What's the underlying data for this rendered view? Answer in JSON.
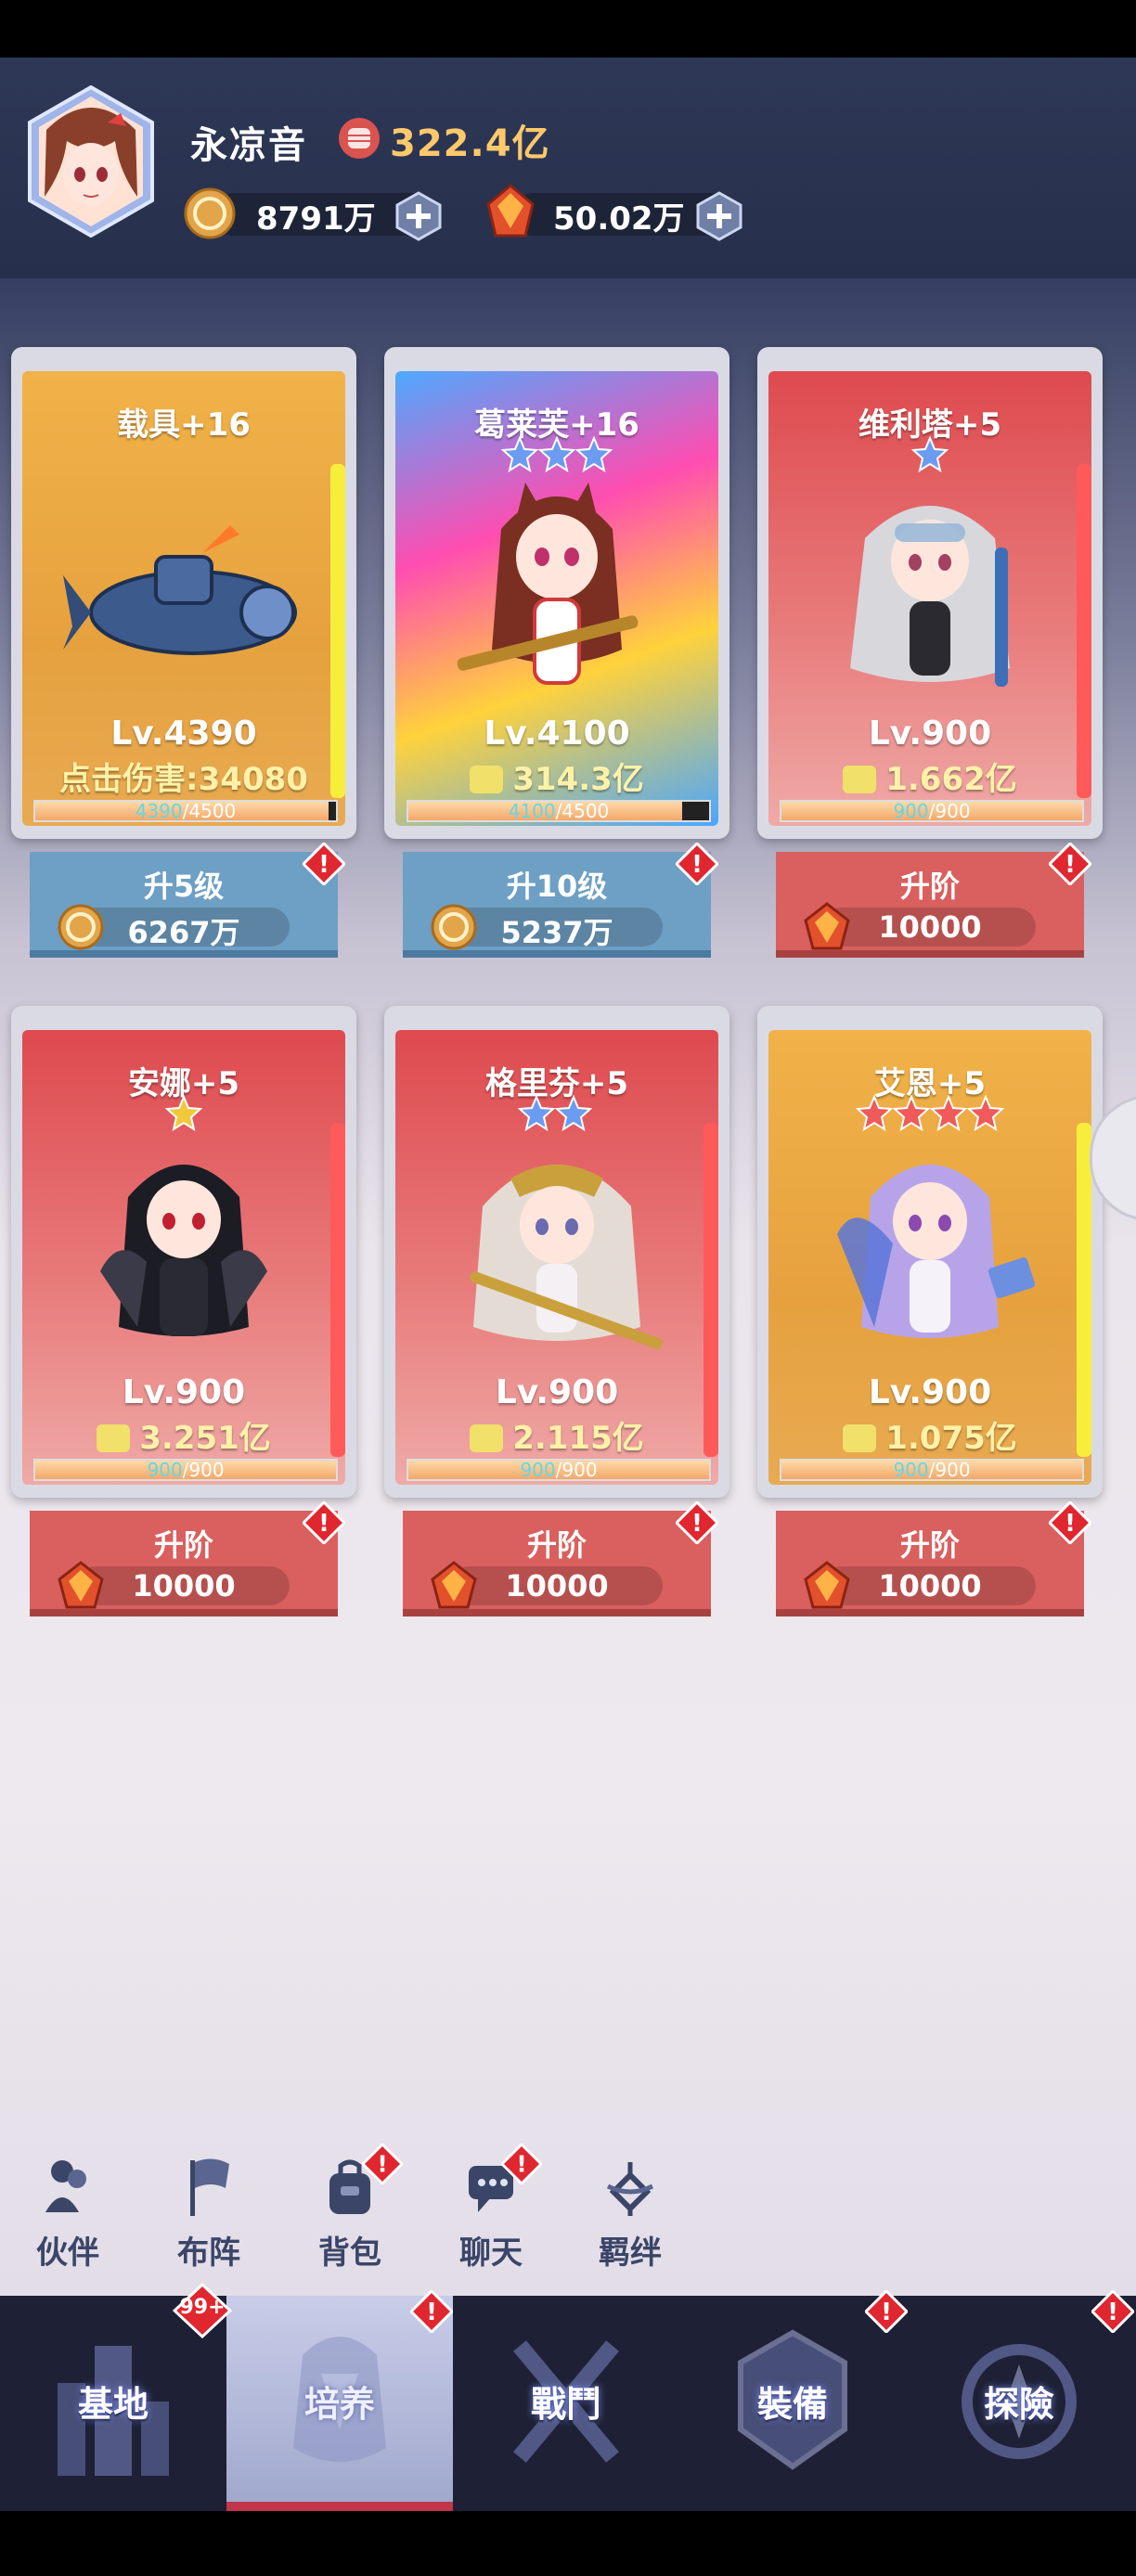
{
  "player": {
    "name": "永凉音",
    "power": "322.4亿"
  },
  "resources": {
    "coins": "8791万",
    "gems": "50.02万"
  },
  "colors": {
    "gold_card": "#e9a93c",
    "rainbow_card": "#ff7bb0",
    "red_card": "#dc5558",
    "blue_button": "#6e9fc4",
    "red_button": "#d9605e"
  },
  "cards": [
    {
      "name": "载具+16",
      "level": "Lv.4390",
      "stat": "点击伤害:34080",
      "stat_icon": "none",
      "progress_current": "4390",
      "progress_max": "4500",
      "progress_fraction": 0.976,
      "button_title": "升5级",
      "cost": "6267万",
      "cost_icon": "coin-icon",
      "theme": "gold",
      "stars": 0,
      "star_color": "none"
    },
    {
      "name": "葛莱芙+16",
      "level": "Lv.4100",
      "stat": "314.3亿",
      "stat_icon": "fist-icon",
      "progress_current": "4100",
      "progress_max": "4500",
      "progress_fraction": 0.911,
      "button_title": "升10级",
      "cost": "5237万",
      "cost_icon": "coin-icon",
      "theme": "rainbow",
      "stars": 3,
      "star_color": "blue-crystal"
    },
    {
      "name": "维利塔+5",
      "level": "Lv.900",
      "stat": "1.662亿",
      "stat_icon": "fist-icon",
      "progress_current": "900",
      "progress_max": "900",
      "progress_fraction": 1,
      "button_title": "升阶",
      "cost": "10000",
      "cost_icon": "gem-icon",
      "theme": "red",
      "stars": 1,
      "star_color": "blue"
    },
    {
      "name": "安娜+5",
      "level": "Lv.900",
      "stat": "3.251亿",
      "stat_icon": "fist-icon",
      "progress_current": "900",
      "progress_max": "900",
      "progress_fraction": 1,
      "button_title": "升阶",
      "cost": "10000",
      "cost_icon": "gem-icon",
      "theme": "red",
      "stars": 1,
      "star_color": "gold"
    },
    {
      "name": "格里芬+5",
      "level": "Lv.900",
      "stat": "2.115亿",
      "stat_icon": "fist-icon",
      "progress_current": "900",
      "progress_max": "900",
      "progress_fraction": 1,
      "button_title": "升阶",
      "cost": "10000",
      "cost_icon": "gem-icon",
      "theme": "red",
      "stars": 2,
      "star_color": "blue"
    },
    {
      "name": "艾恩+5",
      "level": "Lv.900",
      "stat": "1.075亿",
      "stat_icon": "fist-icon",
      "progress_current": "900",
      "progress_max": "900",
      "progress_fraction": 1,
      "button_title": "升阶",
      "cost": "10000",
      "cost_icon": "gem-icon",
      "theme": "gold",
      "stars": 4,
      "star_color": "red"
    }
  ],
  "tools": [
    {
      "label": "伙伴",
      "icon": "partner-icon",
      "alert": false
    },
    {
      "label": "布阵",
      "icon": "flag-icon",
      "alert": false
    },
    {
      "label": "背包",
      "icon": "backpack-icon",
      "alert": true
    },
    {
      "label": "聊天",
      "icon": "chat-icon",
      "alert": true
    },
    {
      "label": "羁绊",
      "icon": "bond-icon",
      "alert": false
    }
  ],
  "nav": [
    {
      "label": "基地",
      "icon": "base-icon",
      "active": false,
      "badge": "99+"
    },
    {
      "label": "培养",
      "icon": "train-icon",
      "active": true,
      "badge": "alert"
    },
    {
      "label": "戰鬥",
      "icon": "battle-icon",
      "active": false,
      "badge": ""
    },
    {
      "label": "裝備",
      "icon": "equip-icon",
      "active": false,
      "badge": "alert"
    },
    {
      "label": "探險",
      "icon": "explore-icon",
      "active": false,
      "badge": "alert"
    }
  ]
}
